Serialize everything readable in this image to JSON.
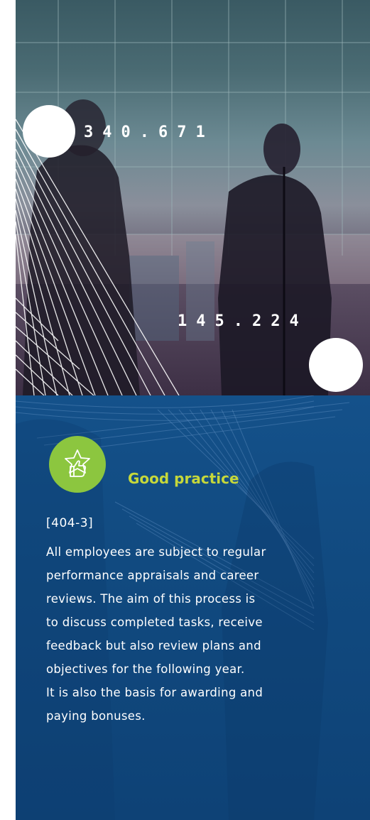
{
  "photo": {
    "counter_top": "340.671",
    "counter_bottom": "145.224"
  },
  "box": {
    "badge_icon": "thumbs-up-star-icon",
    "heading": "Good practice",
    "reference": "[404-3]",
    "lines": [
      "All employees are subject to regular",
      "performance appraisals and career",
      "reviews. The aim of this process is",
      "to discuss completed tasks, receive",
      "feedback but also review plans and",
      "objectives for the following year.",
      "It is also the basis for awarding and",
      "paying bonuses."
    ]
  },
  "colors": {
    "panel_blue": "#124b82",
    "badge_green": "#8cc63f",
    "heading_yellow": "#c6d83a"
  }
}
